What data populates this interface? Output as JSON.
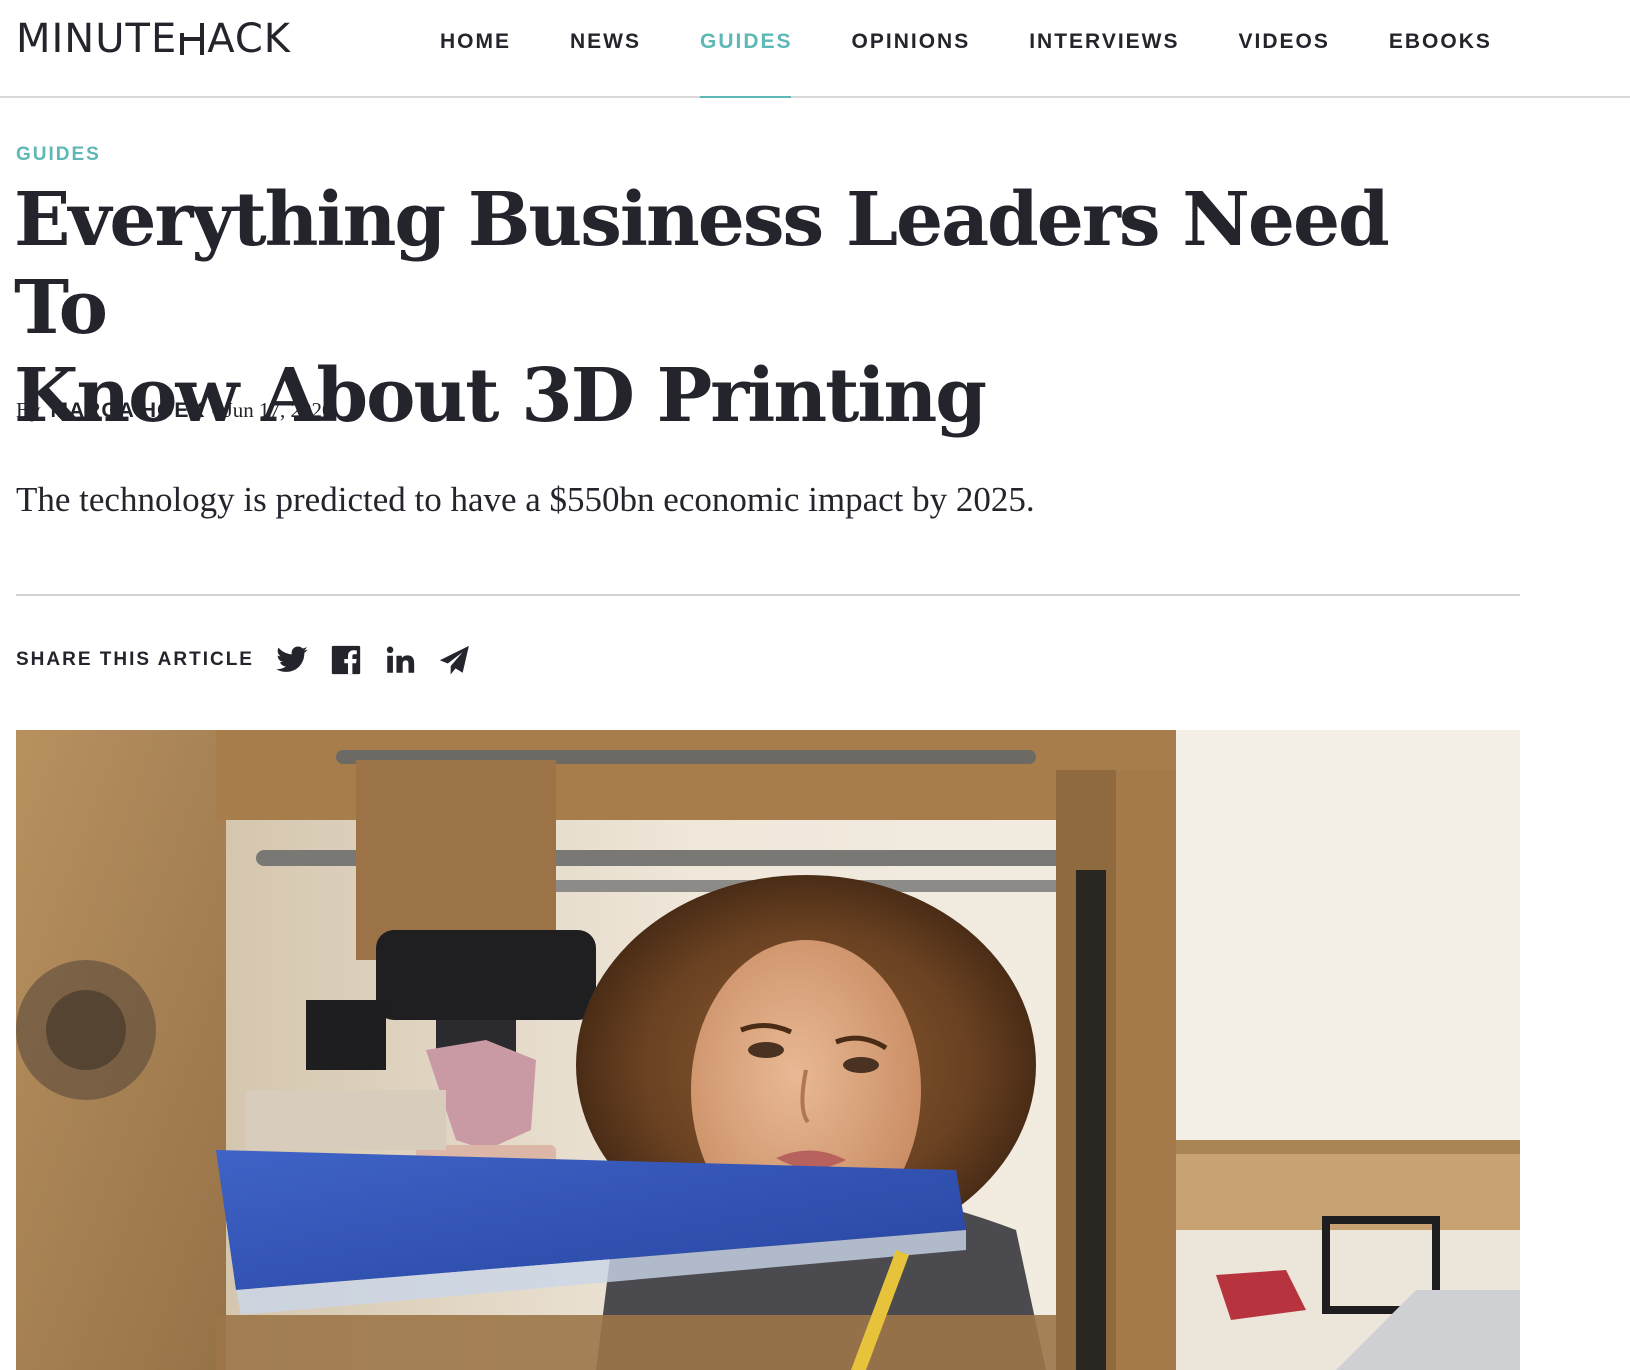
{
  "brand": {
    "logo_before": "MINUTE",
    "logo_after": "ACK",
    "logo_full": "MINUTEHACK"
  },
  "nav": {
    "items": [
      {
        "label": "HOME",
        "active": false
      },
      {
        "label": "NEWS",
        "active": false
      },
      {
        "label": "GUIDES",
        "active": true
      },
      {
        "label": "OPINIONS",
        "active": false
      },
      {
        "label": "INTERVIEWS",
        "active": false
      },
      {
        "label": "VIDEOS",
        "active": false
      },
      {
        "label": "EBOOKS",
        "active": false
      }
    ]
  },
  "article": {
    "category": "GUIDES",
    "title_line1": "Everything Business Leaders Need To",
    "title_line2": "Know About 3D Printing",
    "byline_prefix": "By",
    "author": "MARGA HOEK",
    "separator": "-",
    "date": "Jun 17, 2020",
    "standfirst": "The technology is predicted to have a $550bn economic impact by 2025."
  },
  "share": {
    "label": "SHARE THIS ARTICLE",
    "icons": [
      "twitter-icon",
      "facebook-icon",
      "linkedin-icon",
      "send-icon"
    ]
  },
  "hero_image": {
    "subject": "woman-watching-3d-printer-photo"
  },
  "colors": {
    "accent": "#5db8b6",
    "text": "#23242c",
    "divider": "#d2d2d2"
  }
}
